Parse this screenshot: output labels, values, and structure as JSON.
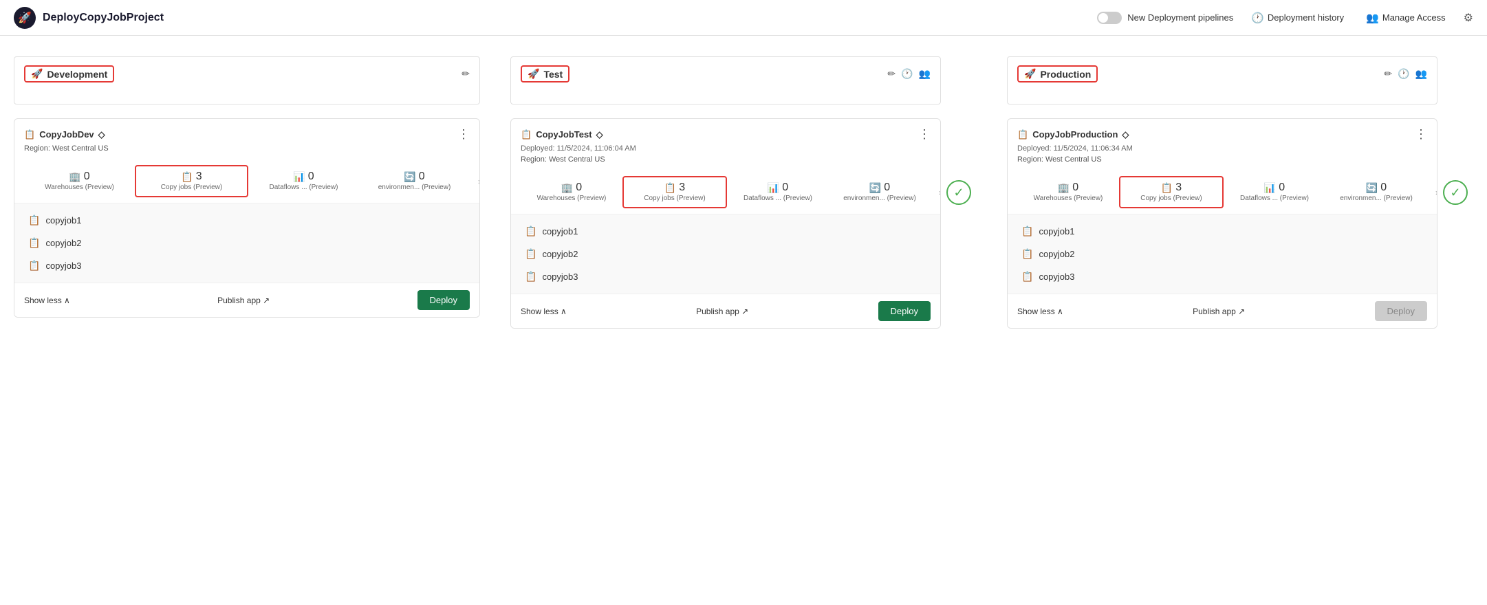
{
  "app": {
    "title": "DeployCopyJobProject",
    "icon": "🚀"
  },
  "header": {
    "toggleLabel": "New Deployment pipelines",
    "historyLabel": "Deployment history",
    "accessLabel": "Manage Access"
  },
  "stages": [
    {
      "id": "development",
      "name": "Development",
      "hasEditIcon": true,
      "hasHistoryIcon": false,
      "hasDeployIcon": false,
      "workspace": {
        "title": "CopyJobDev",
        "deployedText": "",
        "region": "Region: West Central US",
        "stats": [
          {
            "count": "0",
            "label": "Warehouses\n(Preview)",
            "highlighted": false,
            "icon": "🏢"
          },
          {
            "count": "3",
            "label": "Copy jobs\n(Preview)",
            "highlighted": true,
            "icon": "📋"
          },
          {
            "count": "0",
            "label": "Dataflows ...\n(Preview)",
            "highlighted": false,
            "icon": "📊"
          },
          {
            "count": "0",
            "label": "environmen...\n(Preview)",
            "highlighted": false,
            "icon": "🔄"
          }
        ],
        "jobs": [
          "copyjob1",
          "copyjob2",
          "copyjob3"
        ],
        "showLessLabel": "Show less ∧",
        "publishLabel": "Publish app ↗",
        "deployLabel": "Deploy",
        "deployDisabled": false
      }
    },
    {
      "id": "test",
      "name": "Test",
      "hasEditIcon": true,
      "hasHistoryIcon": true,
      "hasDeployIcon": true,
      "workspace": {
        "title": "CopyJobTest",
        "deployedText": "Deployed: 11/5/2024, 11:06:04 AM",
        "region": "Region: West Central US",
        "stats": [
          {
            "count": "0",
            "label": "Warehouses\n(Preview)",
            "highlighted": false,
            "icon": "🏢"
          },
          {
            "count": "3",
            "label": "Copy jobs\n(Preview)",
            "highlighted": true,
            "icon": "📋"
          },
          {
            "count": "0",
            "label": "Dataflows ...\n(Preview)",
            "highlighted": false,
            "icon": "📊"
          },
          {
            "count": "0",
            "label": "environmen...\n(Preview)",
            "highlighted": false,
            "icon": "🔄"
          }
        ],
        "jobs": [
          "copyjob1",
          "copyjob2",
          "copyjob3"
        ],
        "showLessLabel": "Show less ∧",
        "publishLabel": "Publish app ↗",
        "deployLabel": "Deploy",
        "deployDisabled": false
      }
    },
    {
      "id": "production",
      "name": "Production",
      "hasEditIcon": true,
      "hasHistoryIcon": true,
      "hasDeployIcon": true,
      "workspace": {
        "title": "CopyJobProduction",
        "deployedText": "Deployed: 11/5/2024, 11:06:34 AM",
        "region": "Region: West Central US",
        "stats": [
          {
            "count": "0",
            "label": "Warehouses\n(Preview)",
            "highlighted": false,
            "icon": "🏢"
          },
          {
            "count": "3",
            "label": "Copy jobs\n(Preview)",
            "highlighted": true,
            "icon": "📋"
          },
          {
            "count": "0",
            "label": "Dataflows ...\n(Preview)",
            "highlighted": false,
            "icon": "📊"
          },
          {
            "count": "0",
            "label": "environmen...\n(Preview)",
            "highlighted": false,
            "icon": "🔄"
          }
        ],
        "jobs": [
          "copyjob1",
          "copyjob2",
          "copyjob3"
        ],
        "showLessLabel": "Show less ∧",
        "publishLabel": "Publish app ↗",
        "deployLabel": "Deploy",
        "deployDisabled": true
      }
    }
  ]
}
